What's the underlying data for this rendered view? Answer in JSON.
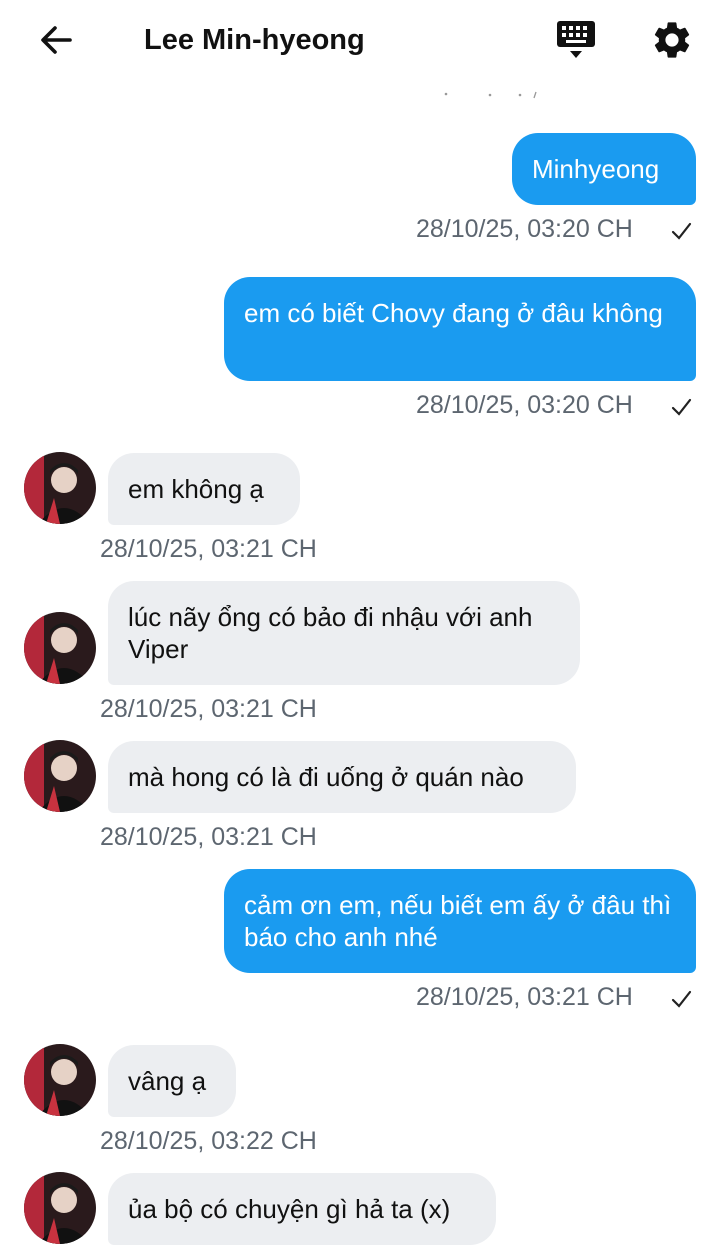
{
  "header": {
    "title": "Lee Min-hyeong",
    "back_icon": "arrow-left-icon",
    "keyboard_icon": "keyboard-icon",
    "settings_icon": "gear-icon"
  },
  "colors": {
    "outgoing_bubble": "#1a9bf0",
    "incoming_bubble": "#eceef1",
    "timestamp": "#5d6670"
  },
  "messages": [
    {
      "direction": "out",
      "text": "Minhyeong",
      "time": "28/10/25, 03:20 CH",
      "status": "sent"
    },
    {
      "direction": "out",
      "text": "em có biết Chovy đang ở đâu không",
      "time": "28/10/25, 03:20 CH",
      "status": "sent"
    },
    {
      "direction": "in",
      "text": "em không ạ",
      "time": "28/10/25, 03:21 CH"
    },
    {
      "direction": "in",
      "text": "lúc nãy ổng có bảo đi nhậu với anh Viper",
      "time": "28/10/25, 03:21 CH"
    },
    {
      "direction": "in",
      "text": "mà hong có là đi uống ở quán nào",
      "time": "28/10/25, 03:21 CH"
    },
    {
      "direction": "out",
      "text": "cảm ơn em, nếu biết em ấy ở đâu thì báo cho anh nhé",
      "time": "28/10/25, 03:21 CH",
      "status": "sent"
    },
    {
      "direction": "in",
      "text": "vâng ạ",
      "time": "28/10/25, 03:22 CH"
    },
    {
      "direction": "in",
      "text": "ủa bộ có chuyện gì hả ta (x)",
      "time": ""
    }
  ]
}
